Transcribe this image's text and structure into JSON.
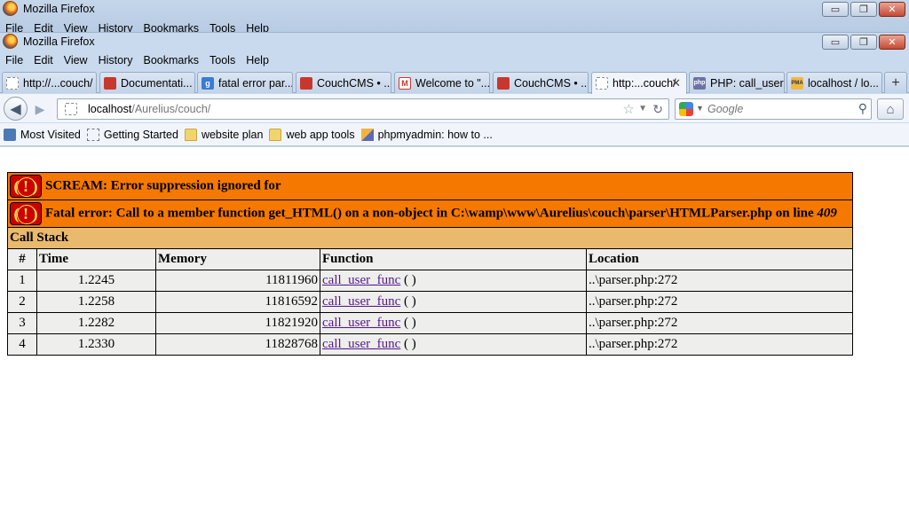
{
  "bg_window": {
    "title": "Mozilla Firefox",
    "menu": [
      "File",
      "Edit",
      "View",
      "History",
      "Bookmarks",
      "Tools",
      "Help"
    ]
  },
  "window": {
    "title": "Mozilla Firefox",
    "controls": {
      "minimize": "▭",
      "restore": "❐",
      "close": "✕"
    }
  },
  "menu": [
    "File",
    "Edit",
    "View",
    "History",
    "Bookmarks",
    "Tools",
    "Help"
  ],
  "tabs": [
    {
      "label": "http://...couch/",
      "icon": "blank-page-icon"
    },
    {
      "label": "Documentati...",
      "icon": "couchcms-icon"
    },
    {
      "label": "fatal error par...",
      "icon": "google-icon"
    },
    {
      "label": "CouchCMS • ...",
      "icon": "couchcms-icon"
    },
    {
      "label": "Welcome to \"...",
      "icon": "gmail-icon"
    },
    {
      "label": "CouchCMS • ...",
      "icon": "couchcms-icon"
    },
    {
      "label": "http:...couch/",
      "icon": "blank-page-icon",
      "active": true
    },
    {
      "label": "PHP: call_user...",
      "icon": "php-icon"
    },
    {
      "label": "localhost / lo...",
      "icon": "phpmyadmin-icon"
    }
  ],
  "new_tab_label": "+",
  "nav": {
    "url_host": "localhost",
    "url_path": "/Aurelius/couch/",
    "search_placeholder": "Google"
  },
  "bookmarks": [
    {
      "label": "Most Visited",
      "icon": "most-visited-icon"
    },
    {
      "label": "Getting Started",
      "icon": "blank-page-icon"
    },
    {
      "label": "website plan",
      "icon": "folder-icon"
    },
    {
      "label": "web app tools",
      "icon": "folder-icon"
    },
    {
      "label": "phpmyadmin: how to ...",
      "icon": "phpmyadmin-icon"
    }
  ],
  "error": {
    "icon_glyph": "( ! )",
    "scream": "SCREAM: Error suppression ignored for",
    "fatal_prefix": "Fatal error: Call to a member function get_HTML() on a non-object in C:\\wamp\\www\\Aurelius\\couch\\parser\\HTMLParser.php on line ",
    "fatal_line": "409",
    "call_stack_title": "Call Stack",
    "columns": [
      "#",
      "Time",
      "Memory",
      "Function",
      "Location"
    ],
    "rows": [
      {
        "n": "1",
        "time": "1.2245",
        "memory": "11811960",
        "func": "call_user_func",
        "args": " ( )",
        "location": "..\\parser.php:272"
      },
      {
        "n": "2",
        "time": "1.2258",
        "memory": "11816592",
        "func": "call_user_func",
        "args": " ( )",
        "location": "..\\parser.php:272"
      },
      {
        "n": "3",
        "time": "1.2282",
        "memory": "11821920",
        "func": "call_user_func",
        "args": " ( )",
        "location": "..\\parser.php:272"
      },
      {
        "n": "4",
        "time": "1.2330",
        "memory": "11828768",
        "func": "call_user_func",
        "args": " ( )",
        "location": "..\\parser.php:272"
      }
    ]
  },
  "colors": {
    "error_header": "#f57900",
    "call_stack_header": "#e9b96e",
    "row_bg": "#eeeeec",
    "link": "#551a8b"
  }
}
